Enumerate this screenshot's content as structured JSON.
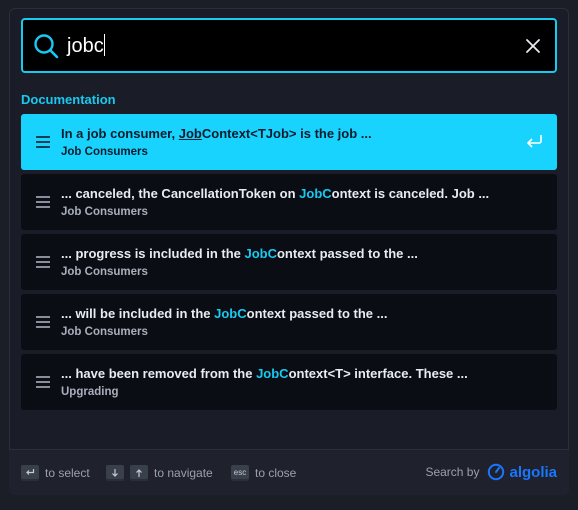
{
  "search": {
    "value": "jobc",
    "placeholder": ""
  },
  "section": {
    "title": "Documentation"
  },
  "hits": [
    {
      "title_pre": "In a job consumer, ",
      "title_hl": "Job",
      "title_post": "Context<TJob> is the job ...",
      "path": "Job Consumers",
      "selected": true
    },
    {
      "title_pre": "... canceled, the CancellationToken on ",
      "title_hl": "JobC",
      "title_post": "ontext is canceled. Job ...",
      "path": "Job Consumers"
    },
    {
      "title_pre": "... progress is included in the ",
      "title_hl": "JobC",
      "title_post": "ontext passed to the ...",
      "path": "Job Consumers"
    },
    {
      "title_pre": "... will be included in the ",
      "title_hl": "JobC",
      "title_post": "ontext passed to the ...",
      "path": "Job Consumers"
    },
    {
      "title_pre": "... have been removed from the ",
      "title_hl": "JobC",
      "title_post": "ontext<T> interface. These ...",
      "path": "Upgrading"
    }
  ],
  "footer": {
    "select_label": "to select",
    "navigate_label": "to navigate",
    "close_label": "to close",
    "esc_key": "esc",
    "search_by": "Search by",
    "brand": "algolia"
  },
  "colors": {
    "accent": "#19c9f0",
    "selected_bg": "#19d3ff",
    "brand": "#1976ff"
  }
}
